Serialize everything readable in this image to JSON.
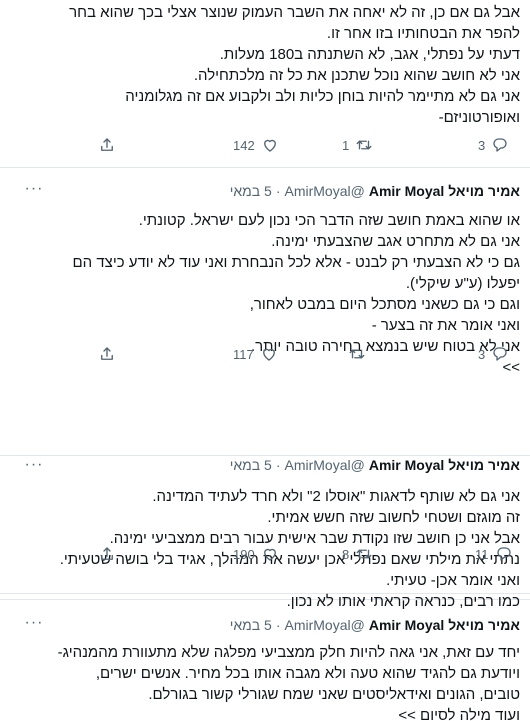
{
  "tweets": [
    {
      "author": "",
      "handle": "",
      "time": "",
      "lines": [
        "אבל גם אם כן, זה לא יאחה את השבר העמוק שנוצר אצלי בכך שהוא בחר",
        "להפר את הבטחותיו בזו אחר זו.",
        "דעתי על נפתלי, אגב, לא השתנתה ב180 מעלות.",
        "אני לא חושב שהוא נוכל שתכנן את כל זה מלכתחילה.",
        "אני גם לא מתיימר להיות בוחן כליות ולב ולקבוע אם זה מגלומניה",
        "ואופורטוניזם-"
      ],
      "counts": {
        "reply": "3",
        "retweet": "1",
        "like": "142"
      }
    },
    {
      "author": "אמיר מויאל Amir Moyal",
      "handle": "@AmirMoyal",
      "dot": "·",
      "time": "5 במאי",
      "lines": [
        "או שהוא באמת חושב שזה הדבר הכי נכון לעם ישראל. קטונתי.",
        "אני גם לא מתחרט אגב שהצבעתי ימינה.",
        "גם כי לא הצבעתי רק לבנט - אלא לכל הנבחרת ואני עוד לא יודע כיצד הם",
        "יפעלו (ע\"ע שיקלי).",
        "וגם כי גם כשאני מסתכל היום במבט לאחור,",
        "ואני אומר את זה בצער -",
        "אני לא בטוח שיש בנמצא בחירה טובה יותר.",
        ">>"
      ],
      "counts": {
        "reply": "3",
        "retweet": "",
        "like": "117"
      }
    },
    {
      "author": "אמיר מויאל Amir Moyal",
      "handle": "@AmirMoyal",
      "dot": "·",
      "time": "5 במאי",
      "lines": [
        "אני גם לא שותף לדאגות \"אוסלו 2\" ולא חרד לעתיד המדינה.",
        "זה מוגזם ושטחי לחשוב שזה חשש אמיתי.",
        "אבל אני כן חושב שזו נקודת שבר אישית עבור רבים ממצביעי ימינה.",
        "נתתי את מילתי שאם נפתלי אכן יעשה את המהלך, אגיד בלי בושה שטעיתי.",
        "ואני אומר אכן- טעיתי.",
        "כמו רבים, כנראה קראתי אותו לא נכון."
      ],
      "counts": {
        "reply": "11",
        "retweet": "8",
        "like": "190"
      }
    },
    {
      "author": "אמיר מויאל Amir Moyal",
      "handle": "@AmirMoyal",
      "dot": "·",
      "time": "5 במאי",
      "lines": [
        "יחד עם זאת, אני גאה להיות חלק ממצביעי מפלגה שלא מתעוורת מהמנהיג-",
        "ויודעת גם להגיד שהוא טעה ולא מגבה אותו בכל מחיר. אנשים ישרים,",
        "טובים, הגונים ואידאליסטים שאני שמח שגורלי קשור בגורלם.",
        "ועוד מילה לסיום >>"
      ],
      "counts": {
        "reply": "",
        "retweet": "",
        "like": ""
      }
    }
  ],
  "icons": {
    "reply": "reply-icon",
    "retweet": "retweet-icon",
    "like": "heart-icon",
    "share": "share-icon",
    "more": "more-icon"
  },
  "colors": {
    "text": "#0f1419",
    "secondary": "#536471",
    "divider": "#e1e8ed"
  }
}
